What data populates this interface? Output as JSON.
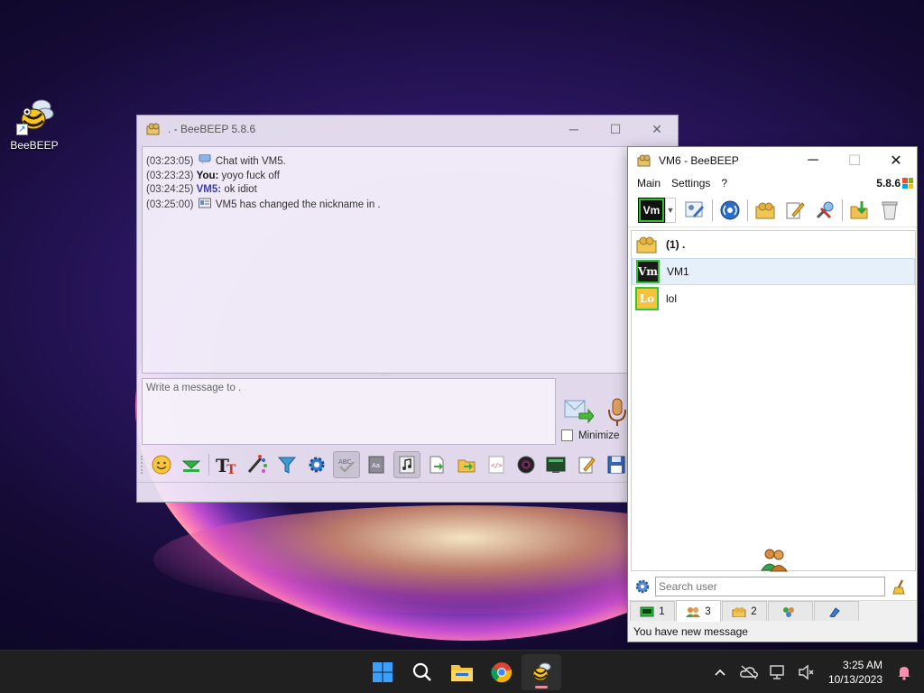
{
  "desktop": {
    "icon_label": "BeeBEEP"
  },
  "chat_window": {
    "title": ". - BeeBEEP 5.8.6",
    "history": [
      {
        "time": "(03:23:05)",
        "icon": "chat-bubble-icon",
        "sender": "",
        "text": "Chat with VM5."
      },
      {
        "time": "(03:23:23)",
        "icon": "",
        "sender": "You:",
        "text": "yoyo fuck off"
      },
      {
        "time": "(03:24:25)",
        "icon": "",
        "sender": "VM5:",
        "text": "ok idiot"
      },
      {
        "time": "(03:25:00)",
        "icon": "info-card-icon",
        "sender": "",
        "text": "VM5 has changed the nickname in ."
      }
    ],
    "composer_placeholder": "Write a message to .",
    "minimize_label": "Minimize"
  },
  "main_window": {
    "title": "VM6 - BeeBEEP",
    "menu": [
      "Main",
      "Settings",
      "?"
    ],
    "version": "5.8.6",
    "status_avatar": "Vm",
    "users": [
      {
        "name": "(1) .",
        "avatar": "group-chat-icon",
        "bold": true
      },
      {
        "name": "VM1",
        "avatar": "Vm",
        "bold": false
      },
      {
        "name": "lol",
        "avatar": "Lo",
        "bold": false
      }
    ],
    "search_placeholder": "Search user",
    "tabs": [
      {
        "icon": "chat-tab-icon",
        "count": "1"
      },
      {
        "icon": "users-tab-icon",
        "count": "3"
      },
      {
        "icon": "groups-tab-icon",
        "count": "2"
      },
      {
        "icon": "network-tab-icon",
        "count": ""
      },
      {
        "icon": "share-tab-icon",
        "count": ""
      }
    ],
    "status_text": "You have new message"
  },
  "taskbar": {
    "time": "3:25 AM",
    "date": "10/13/2023"
  },
  "colors": {
    "taskbar_bg": "#202020",
    "selected_row": "#e6f0fb",
    "online_green": "#2fbf2f"
  }
}
